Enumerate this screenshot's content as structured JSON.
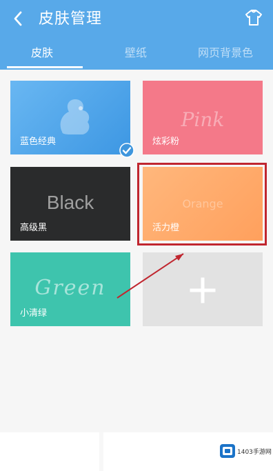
{
  "header": {
    "title": "皮肤管理",
    "tabs": [
      {
        "label": "皮肤",
        "active": true
      },
      {
        "label": "壁纸",
        "active": false
      },
      {
        "label": "网页背景色",
        "active": false
      }
    ]
  },
  "skins": [
    {
      "id": "blue",
      "label": "蓝色经典",
      "selected": true,
      "icon": "squirrel-icon"
    },
    {
      "id": "pink",
      "label": "炫彩粉",
      "watermark": "Pink"
    },
    {
      "id": "black",
      "label": "高级黑",
      "watermark": "Black"
    },
    {
      "id": "orange",
      "label": "活力橙",
      "watermark": "Orange"
    },
    {
      "id": "green",
      "label": "小清绿",
      "watermark": "Green"
    },
    {
      "id": "add",
      "label": "",
      "icon": "plus-icon"
    }
  ],
  "watermark_brand": {
    "text": "1403手游网"
  },
  "colors": {
    "header": "#58a9e9",
    "highlight": "#c0262f"
  }
}
